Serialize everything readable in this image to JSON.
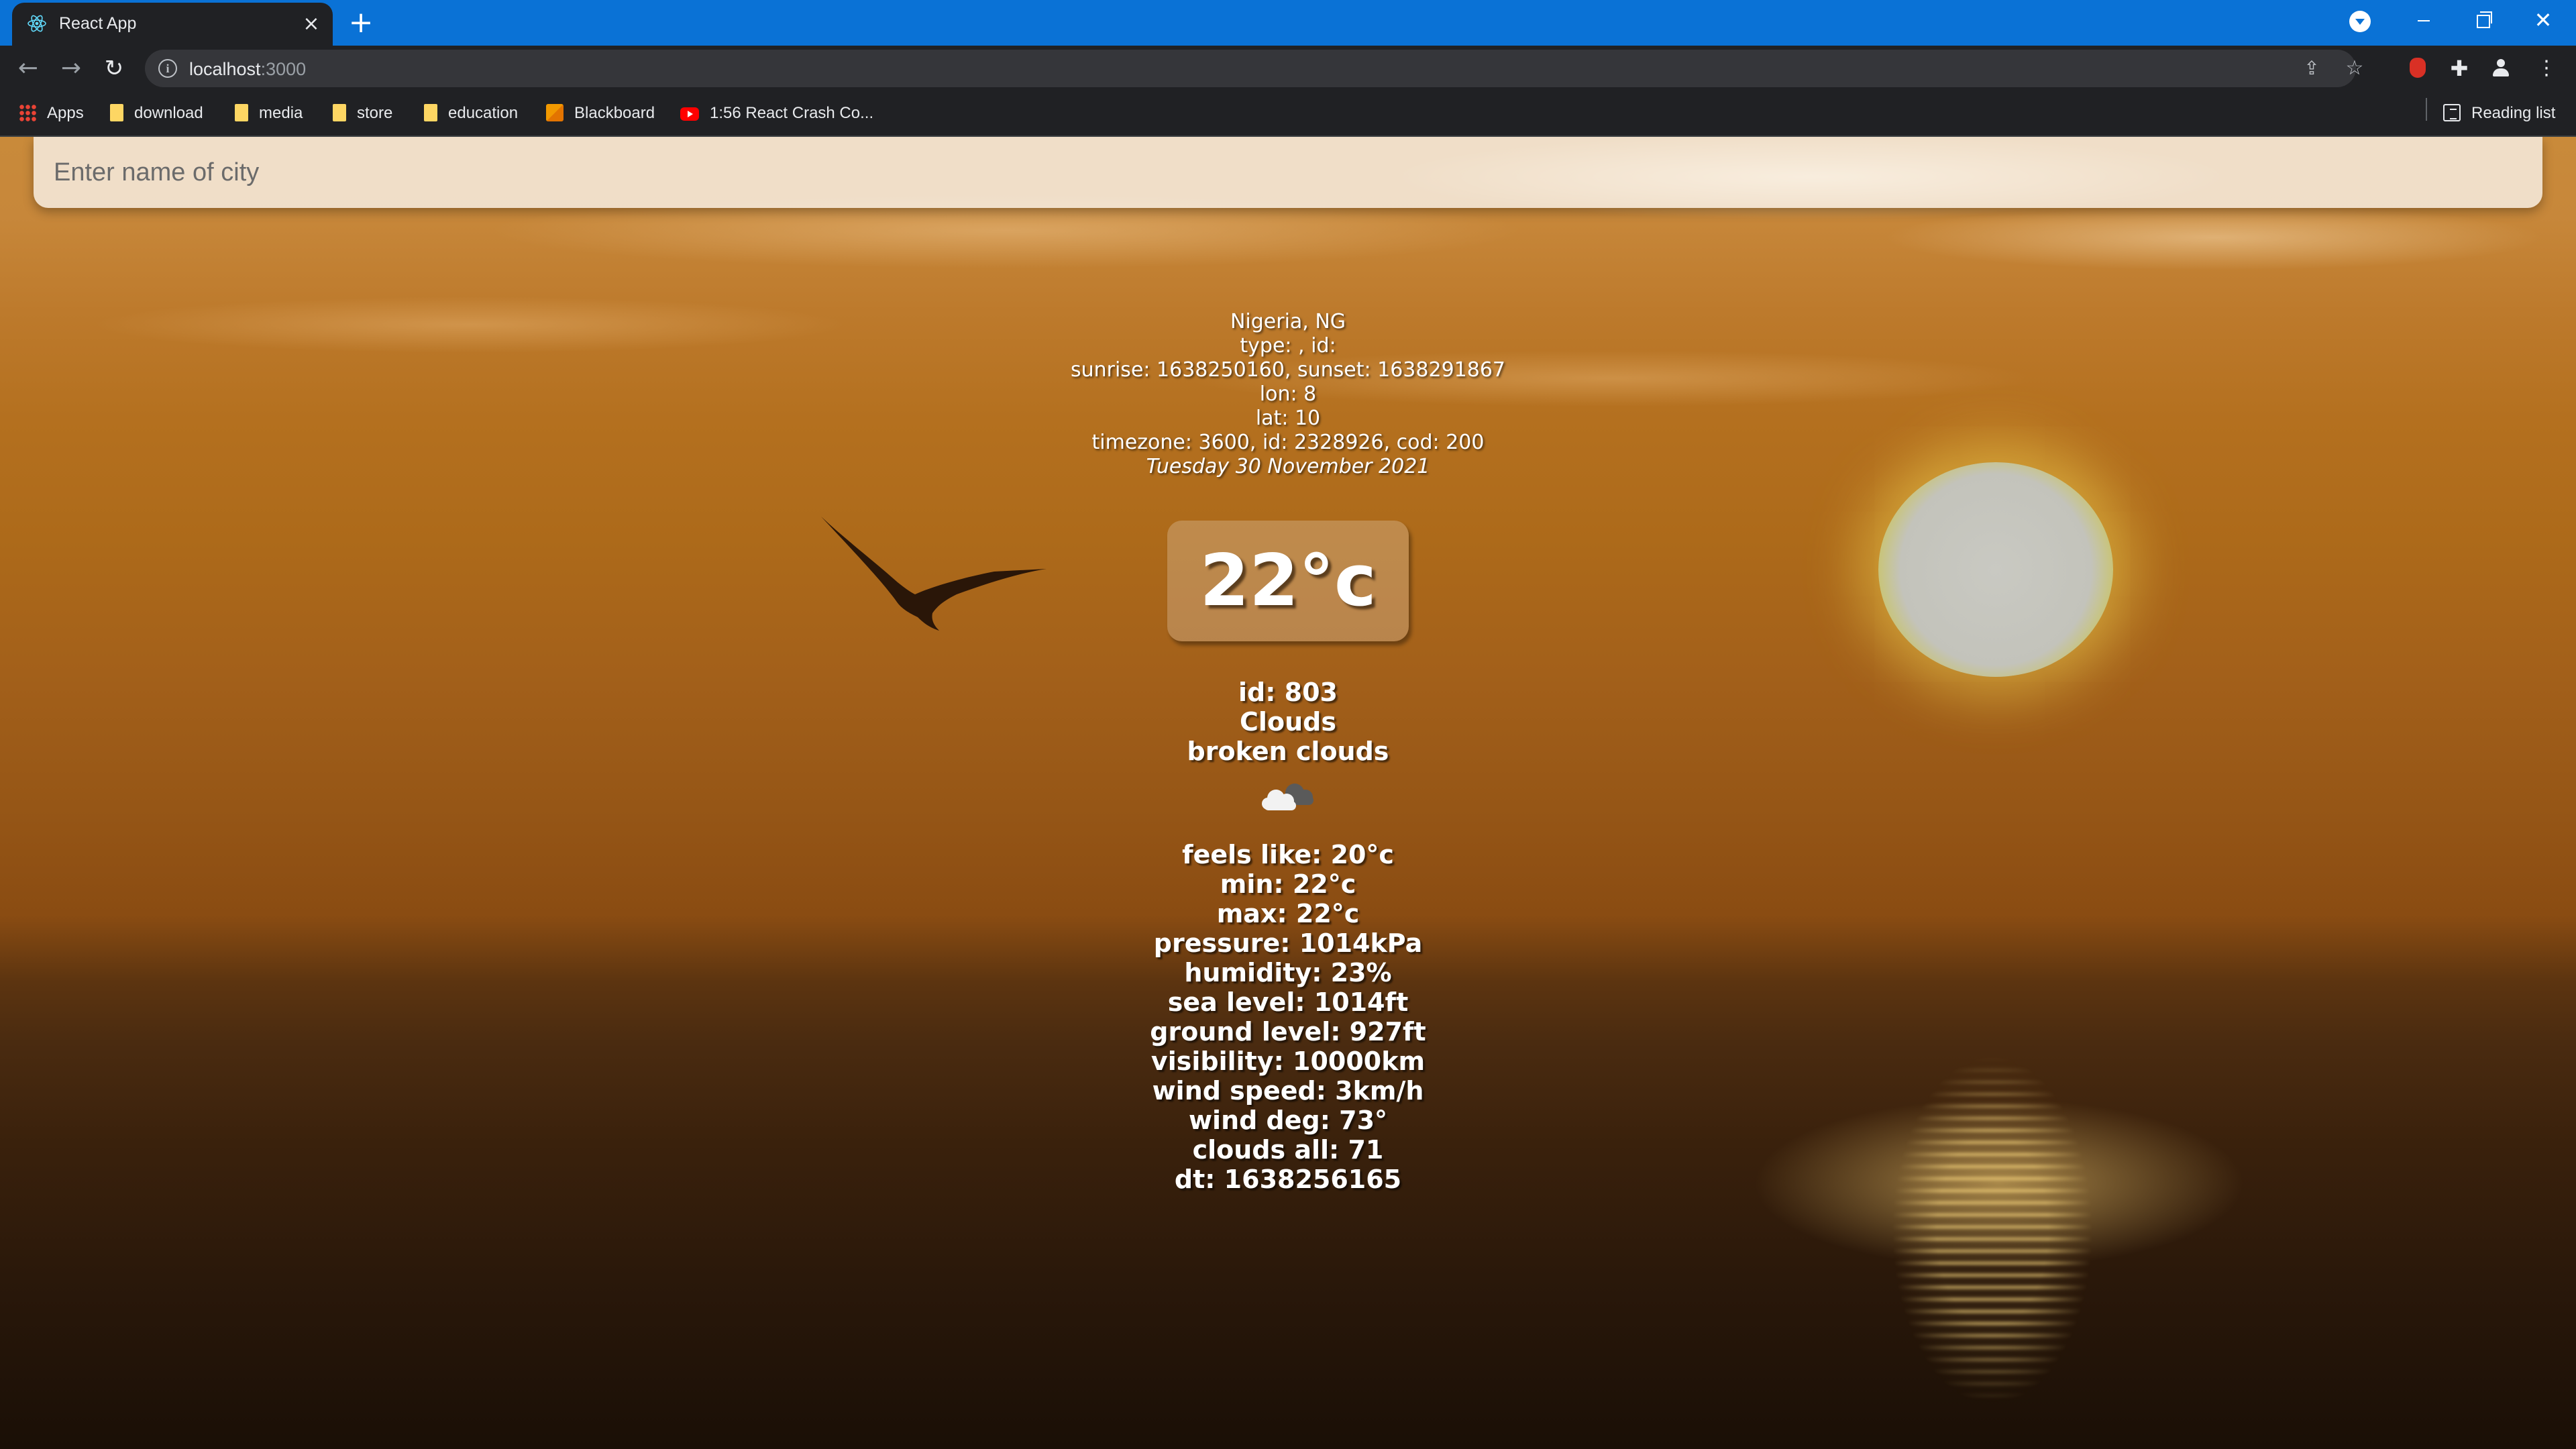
{
  "browser": {
    "tab_title": "React App",
    "url_host": "localhost",
    "url_port": ":3000",
    "bookmarks": {
      "apps": "Apps",
      "download": "download",
      "media": "media",
      "store": "store",
      "education": "education",
      "blackboard": "Blackboard",
      "youtube": "1:56 React Crash Co...",
      "reading_list": "Reading list"
    }
  },
  "search": {
    "placeholder": "Enter name of city"
  },
  "location": {
    "country": "Nigeria, NG",
    "sys": "type: , id:",
    "sun_times": "sunrise: 1638250160, sunset: 1638291867",
    "lon": "lon: 8",
    "lat": "lat: 10",
    "meta": "timezone: 3600, id: 2328926, cod: 200",
    "date": "Tuesday 30 November 2021"
  },
  "temperature": "22°c",
  "weather": {
    "id": "id: 803",
    "main": "Clouds",
    "description": "broken clouds",
    "icon": "broken-clouds-icon"
  },
  "details": {
    "feels_like": "feels like: 20°c",
    "min": "min: 22°c",
    "max": "max: 22°c",
    "pressure": "pressure: 1014kPa",
    "humidity": "humidity: 23%",
    "sea_level": "sea level: 1014ft",
    "ground_level": "ground level: 927ft",
    "visibility": "visibility: 10000km",
    "wind_speed": "wind speed: 3km/h",
    "wind_deg": "wind deg: 73°",
    "clouds_all": "clouds all: 71",
    "dt": "dt: 1638256165"
  },
  "colors": {
    "tab_strip": "#0a72d6",
    "toolbar": "#202124",
    "text_white": "#ffffff"
  }
}
